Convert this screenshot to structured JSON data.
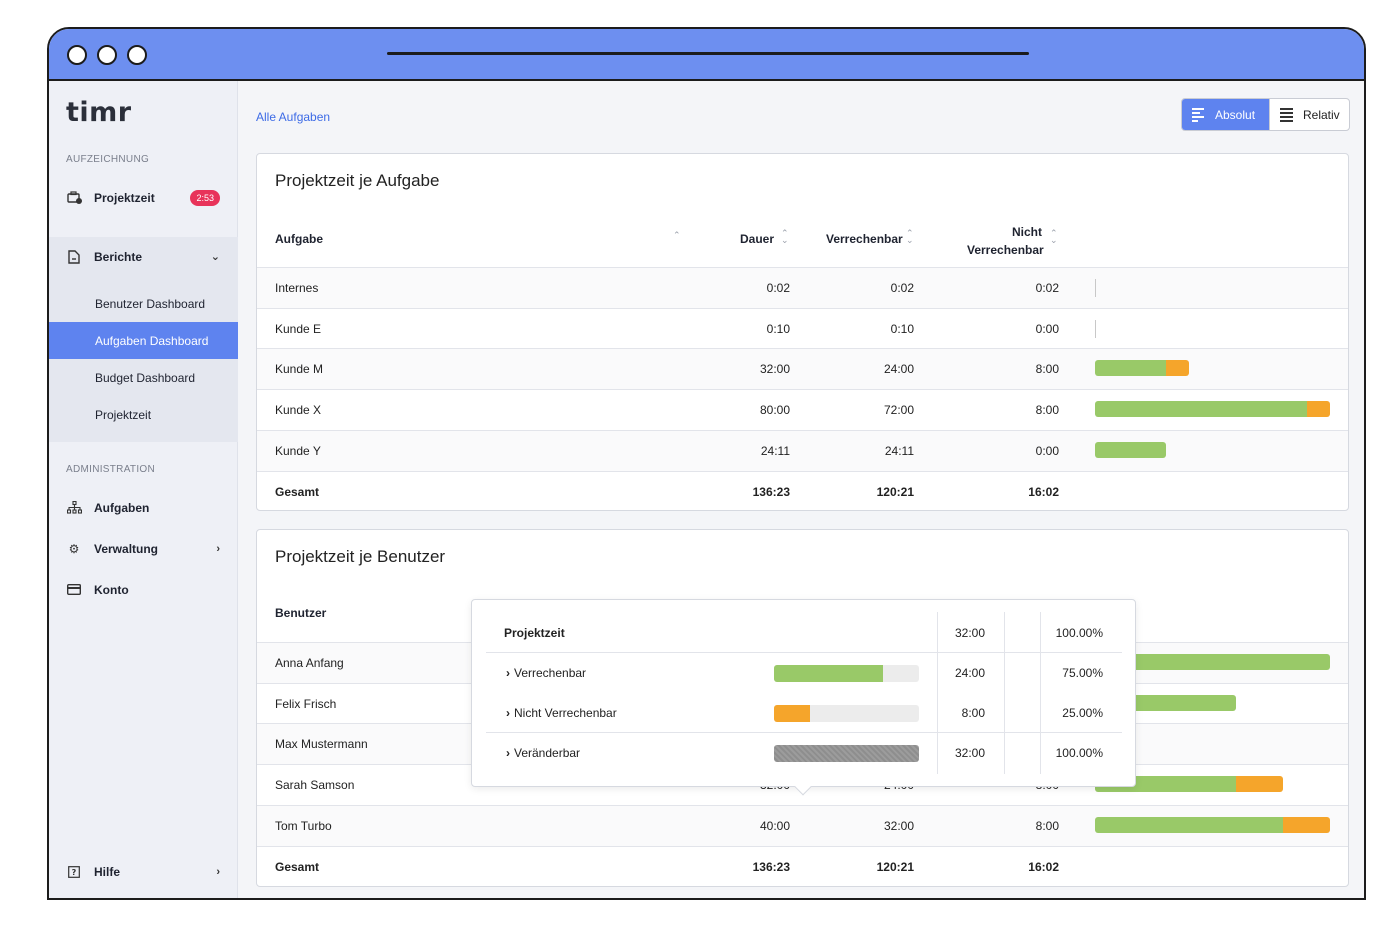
{
  "app": {
    "logo": "timr"
  },
  "sidebar": {
    "section_recording": "AUFZEICHNUNG",
    "projektzeit": {
      "label": "Projektzeit",
      "badge": "2:53",
      "icon": "briefcase-clock-icon"
    },
    "berichte": {
      "label": "Berichte",
      "icon": "document-icon",
      "items": [
        "Benutzer Dashboard",
        "Aufgaben Dashboard",
        "Budget Dashboard",
        "Projektzeit"
      ],
      "active": "Aufgaben Dashboard"
    },
    "section_admin": "ADMINISTRATION",
    "aufgaben": {
      "label": "Aufgaben",
      "icon": "hierarchy-icon"
    },
    "verwaltung": {
      "label": "Verwaltung",
      "icon": "gear-icon"
    },
    "konto": {
      "label": "Konto",
      "icon": "credit-card-icon"
    },
    "hilfe": {
      "label": "Hilfe",
      "icon": "help-icon"
    }
  },
  "header": {
    "breadcrumb": "Alle Aufgaben",
    "toggle": {
      "absolut": "Absolut",
      "relativ": "Relativ",
      "active": "Absolut"
    }
  },
  "colors": {
    "accent": "#5e83ef",
    "billable": "#99c968",
    "nonbillable": "#f5a52b",
    "badge": "#e8335a"
  },
  "task_table": {
    "title": "Projektzeit je Aufgabe",
    "columns": {
      "name": "Aufgabe",
      "dauer": "Dauer",
      "verrechenbar": "Verrechenbar",
      "nicht_1": "Nicht",
      "nicht_2": "Verrechenbar"
    },
    "rows": [
      {
        "name": "Internes",
        "dauer": "0:02",
        "verr": "0:02",
        "nicht": "0:02",
        "billable_hours": 0.03,
        "nonbillable_hours": 0.03
      },
      {
        "name": "Kunde E",
        "dauer": "0:10",
        "verr": "0:10",
        "nicht": "0:00",
        "billable_hours": 0.17,
        "nonbillable_hours": 0
      },
      {
        "name": "Kunde M",
        "dauer": "32:00",
        "verr": "24:00",
        "nicht": "8:00",
        "billable_hours": 24,
        "nonbillable_hours": 8
      },
      {
        "name": "Kunde X",
        "dauer": "80:00",
        "verr": "72:00",
        "nicht": "8:00",
        "billable_hours": 72,
        "nonbillable_hours": 8
      },
      {
        "name": "Kunde Y",
        "dauer": "24:11",
        "verr": "24:11",
        "nicht": "0:00",
        "billable_hours": 24.18,
        "nonbillable_hours": 0
      }
    ],
    "total": {
      "name": "Gesamt",
      "dauer": "136:23",
      "verr": "120:21",
      "nicht": "16:02"
    },
    "max_hours": 80
  },
  "user_table": {
    "title": "Projektzeit je Benutzer",
    "columns": {
      "name": "Benutzer"
    },
    "rows": [
      {
        "name": "Anna Anfang",
        "dauer": "",
        "verr": "",
        "nicht": "",
        "billable_hours": 80,
        "nonbillable_hours": 0
      },
      {
        "name": "Felix Frisch",
        "dauer": "",
        "verr": "",
        "nicht": "",
        "billable_hours": 48,
        "nonbillable_hours": 0
      },
      {
        "name": "Max Mustermann",
        "dauer": "",
        "verr": "",
        "nicht": "",
        "billable_hours": 0,
        "nonbillable_hours": 0
      },
      {
        "name": "Sarah Samson",
        "dauer": "32:00",
        "verr": "24:00",
        "nicht": "8:00",
        "billable_hours": 48,
        "nonbillable_hours": 16
      },
      {
        "name": "Tom Turbo",
        "dauer": "40:00",
        "verr": "32:00",
        "nicht": "8:00",
        "billable_hours": 64,
        "nonbillable_hours": 16
      }
    ],
    "total": {
      "name": "Gesamt",
      "dauer": "136:23",
      "verr": "120:21",
      "nicht": "16:02"
    },
    "max_hours": 80
  },
  "popover": {
    "header": {
      "label": "Projektzeit",
      "time": "32:00",
      "percent": "100.00%"
    },
    "rows": [
      {
        "label": "Verrechenbar",
        "time": "24:00",
        "percent": "75.00%",
        "fraction": 0.75,
        "color": "#99c968"
      },
      {
        "label": "Nicht Verrechenbar",
        "time": "8:00",
        "percent": "25.00%",
        "fraction": 0.25,
        "color": "#f5a52b"
      },
      {
        "label": "Veränderbar",
        "time": "32:00",
        "percent": "100.00%",
        "fraction": 1.0,
        "color": "#8e8e8e"
      }
    ]
  }
}
